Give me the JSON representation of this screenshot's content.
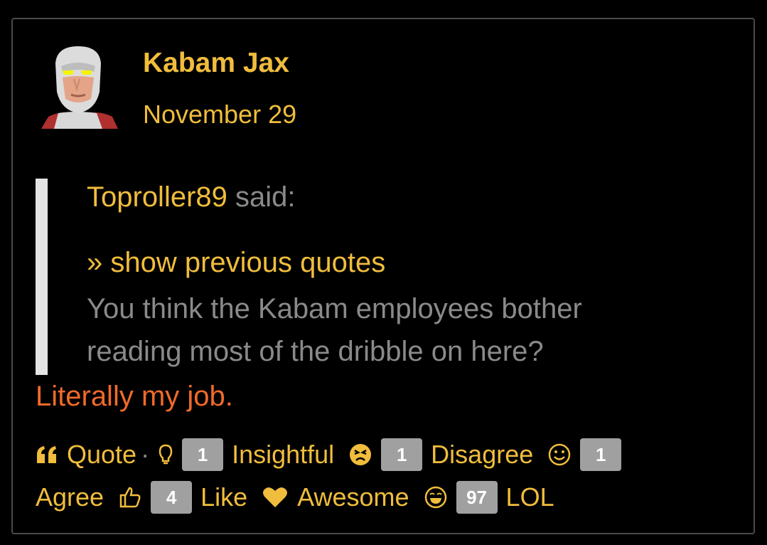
{
  "post": {
    "author": "Kabam Jax",
    "date": "November 29"
  },
  "quote": {
    "author": "Toproller89",
    "said": "said:",
    "show_previous": "» show previous quotes",
    "text": "You think the Kabam employees bother reading most of the dribble on here?"
  },
  "reply": {
    "text": "Literally my job."
  },
  "reactions": {
    "quote_label": "Quote",
    "separator": "·",
    "items": [
      {
        "icon": "lightbulb-icon",
        "count": "1",
        "label": "Insightful"
      },
      {
        "icon": "angry-face-icon",
        "count": "1",
        "label": "Disagree"
      },
      {
        "icon": "smile-face-icon",
        "count": "1",
        "label": "Agree"
      },
      {
        "icon": "thumbs-up-icon",
        "count": "4",
        "label": "Like"
      },
      {
        "icon": "heart-icon",
        "count": "",
        "label": "Awesome"
      },
      {
        "icon": "laugh-face-icon",
        "count": "97",
        "label": "LOL"
      }
    ]
  },
  "colors": {
    "accent": "#f0bd3c",
    "muted": "#8a8a8a",
    "reply": "#f06a2a",
    "badge": "#a0a0a0"
  }
}
